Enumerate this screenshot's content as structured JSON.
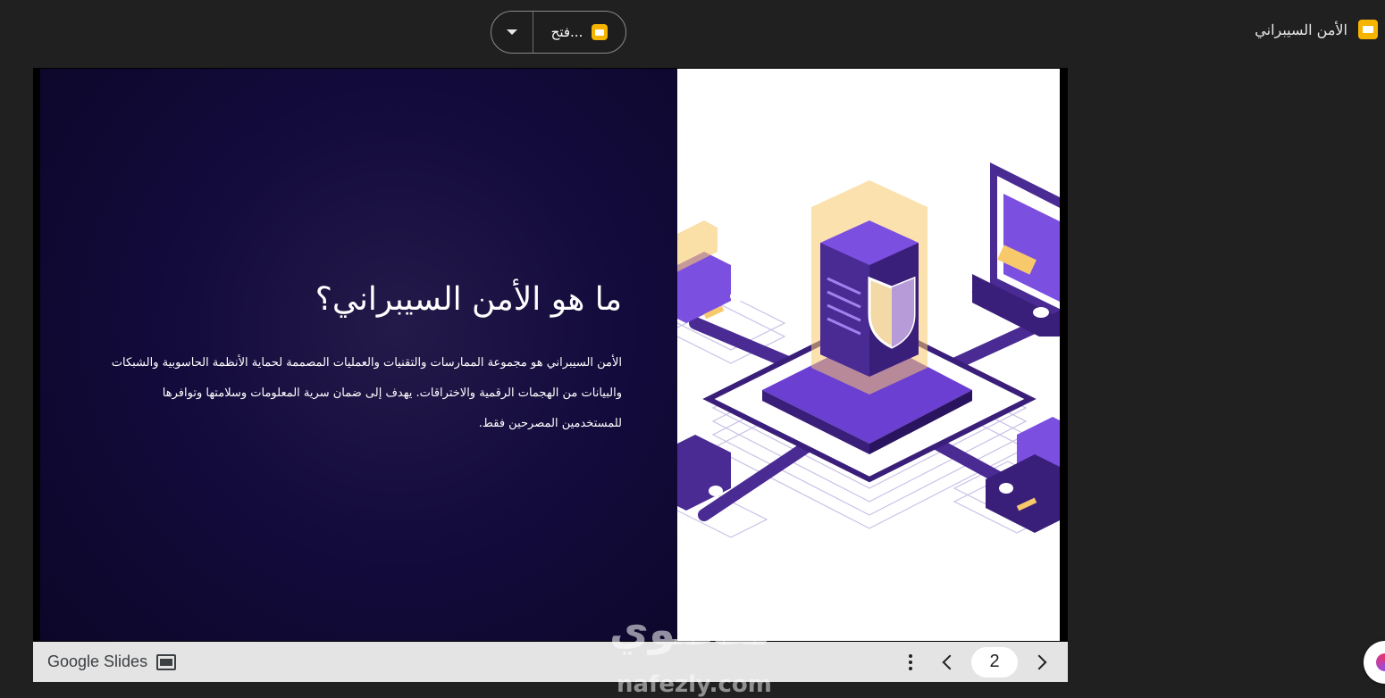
{
  "file": {
    "name": "الأمن السيبراني",
    "icon": "google-slides-icon"
  },
  "open_with": {
    "label": "فتح...",
    "icon": "google-slides-icon",
    "dropdown_icon": "caret-down-icon"
  },
  "slide": {
    "title": "ما هو الأمن السيبراني؟",
    "body_lines": [
      "الأمن السيبراني هو مجموعة الممارسات والتقنيات والعمليات المصممة لحماية الأنظمة الحاسوبية والشبكات",
      "والبيانات من الهجمات الرقمية والاختراقات. يهدف إلى ضمان سرية المعلومات وسلامتها وتوافرها",
      "للمستخدمين المصرحين فقط."
    ],
    "illustration": "isometric-cybersecurity-server-shield-network-illustration"
  },
  "toolbar": {
    "brand": "Google Slides",
    "brand_icon": "slides-presentation-icon",
    "page": "2",
    "more_icon": "more-vert-icon",
    "prev_icon": "chevron-left-icon",
    "next_icon": "chevron-right-icon"
  },
  "watermark": {
    "text": "نفخلوي",
    "url": "nafezly.com"
  },
  "colors": {
    "background": "#202020",
    "slide_dark": "#0b0626",
    "accent_purple": "#6a3fd1",
    "accent_gold": "#f5b400",
    "toolbar": "#e4e4e4"
  }
}
